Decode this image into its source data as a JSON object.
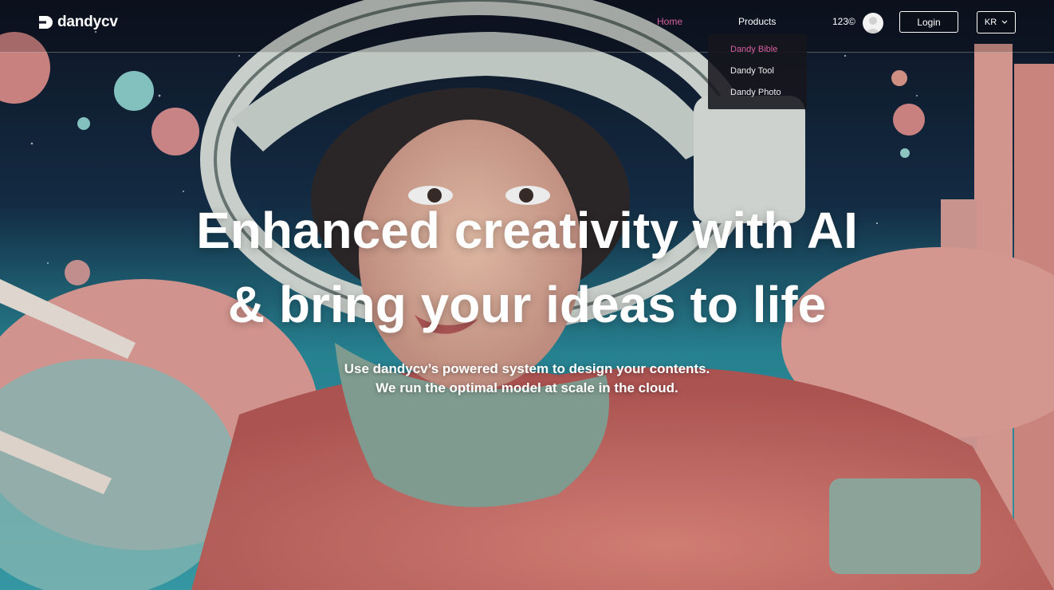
{
  "brand": {
    "name": "dandycv",
    "logo_icon": "dandycv-logo-icon",
    "accent_color": "#d6609e"
  },
  "nav": {
    "home_label": "Home",
    "products_label": "Products",
    "products_menu": [
      {
        "label": "Dandy Bible",
        "active": true
      },
      {
        "label": "Dandy Tool",
        "active": false
      },
      {
        "label": "Dandy Photo",
        "active": false
      }
    ]
  },
  "account": {
    "credits": "123",
    "credits_icon": "coin-icon",
    "avatar_icon": "user-avatar-icon",
    "login_label": "Login"
  },
  "language": {
    "selected": "KR",
    "icon": "chevron-down-icon"
  },
  "hero": {
    "headline_line1": "Enhanced creativity with AI",
    "headline_line2": "& bring your ideas to life",
    "sub_line1": "Use dandycv’s powered system to design your contents.",
    "sub_line2": "We run the optimal model at scale in the cloud.",
    "background_image": "illustrated astronaut girl in pink spacesuit"
  }
}
